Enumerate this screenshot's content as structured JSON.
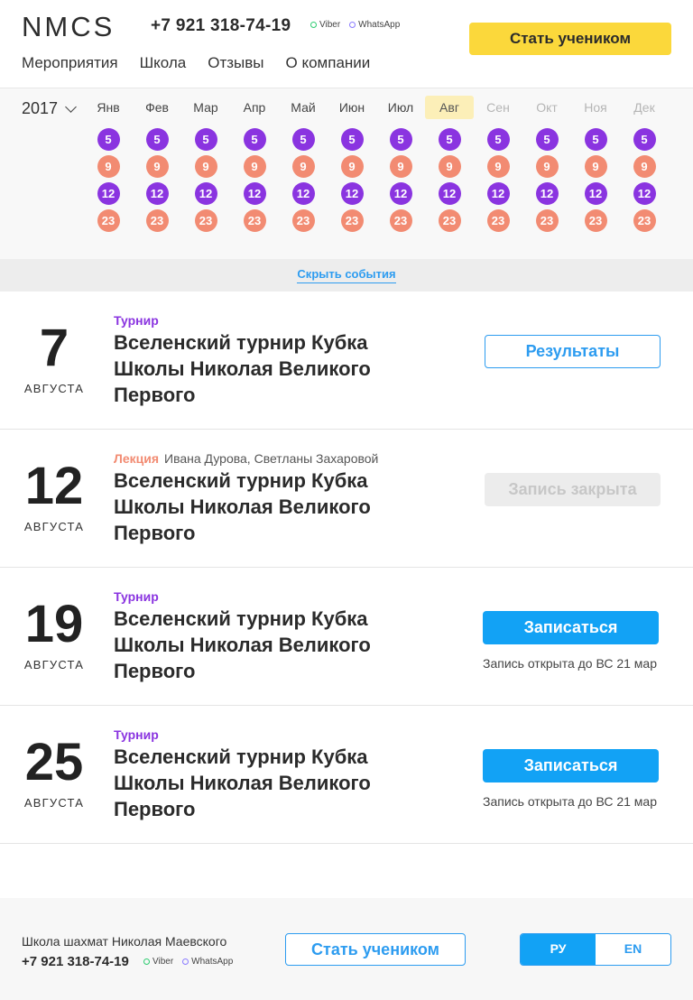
{
  "header": {
    "logo": "NMCS",
    "phone": "+7 921 318-74-19",
    "messengers": [
      "Viber",
      "WhatsApp"
    ],
    "cta": "Стать учеником",
    "nav": [
      "Мероприятия",
      "Школа",
      "Отзывы",
      "О компании"
    ]
  },
  "calendar": {
    "year": "2017",
    "months": [
      "Янв",
      "Фев",
      "Мар",
      "Апр",
      "Май",
      "Июн",
      "Июл",
      "Авг",
      "Сен",
      "Окт",
      "Ноя",
      "Дек"
    ],
    "active_month": "Авг",
    "days": [
      "5",
      "9",
      "12",
      "23"
    ],
    "colors": {
      "purple": "#8a34e0",
      "salmon": "#f28b72",
      "active_bg": "#fcefb8"
    }
  },
  "hide_events": "Скрыть события",
  "events": [
    {
      "day": "7",
      "month": "АВГУСТА",
      "type": "Турнир",
      "speaker": "",
      "title": "Вселенский турнир Кубка Школы Николая Великого Первого",
      "button": "Результаты",
      "note": ""
    },
    {
      "day": "12",
      "month": "АВГУСТА",
      "type": "Лекция",
      "speaker": "Ивана Дурова, Светланы Захаровой",
      "title": "Вселенский турнир Кубка Школы Николая Великого Первого",
      "button": "Запись закрыта",
      "note": ""
    },
    {
      "day": "19",
      "month": "АВГУСТА",
      "type": "Турнир",
      "speaker": "",
      "title": "Вселенский турнир Кубка Школы Николая Великого Первого",
      "button": "Записаться",
      "note": "Запись открыта до ВС 21 мар"
    },
    {
      "day": "25",
      "month": "АВГУСТА",
      "type": "Турнир",
      "speaker": "",
      "title": "Вселенский турнир Кубка Школы Николая Великого Первого",
      "button": "Записаться",
      "note": "Запись открыта до ВС 21 мар"
    }
  ],
  "footer": {
    "school": "Школа шахмат Николая Маевского",
    "phone": "+7 921 318-74-19",
    "messengers": [
      "Viber",
      "WhatsApp"
    ],
    "cta": "Стать учеником",
    "languages": [
      "РУ",
      "EN"
    ],
    "active_language": "РУ"
  },
  "accent": {
    "yellow": "#fbd83b",
    "blue": "#12a2f5"
  }
}
